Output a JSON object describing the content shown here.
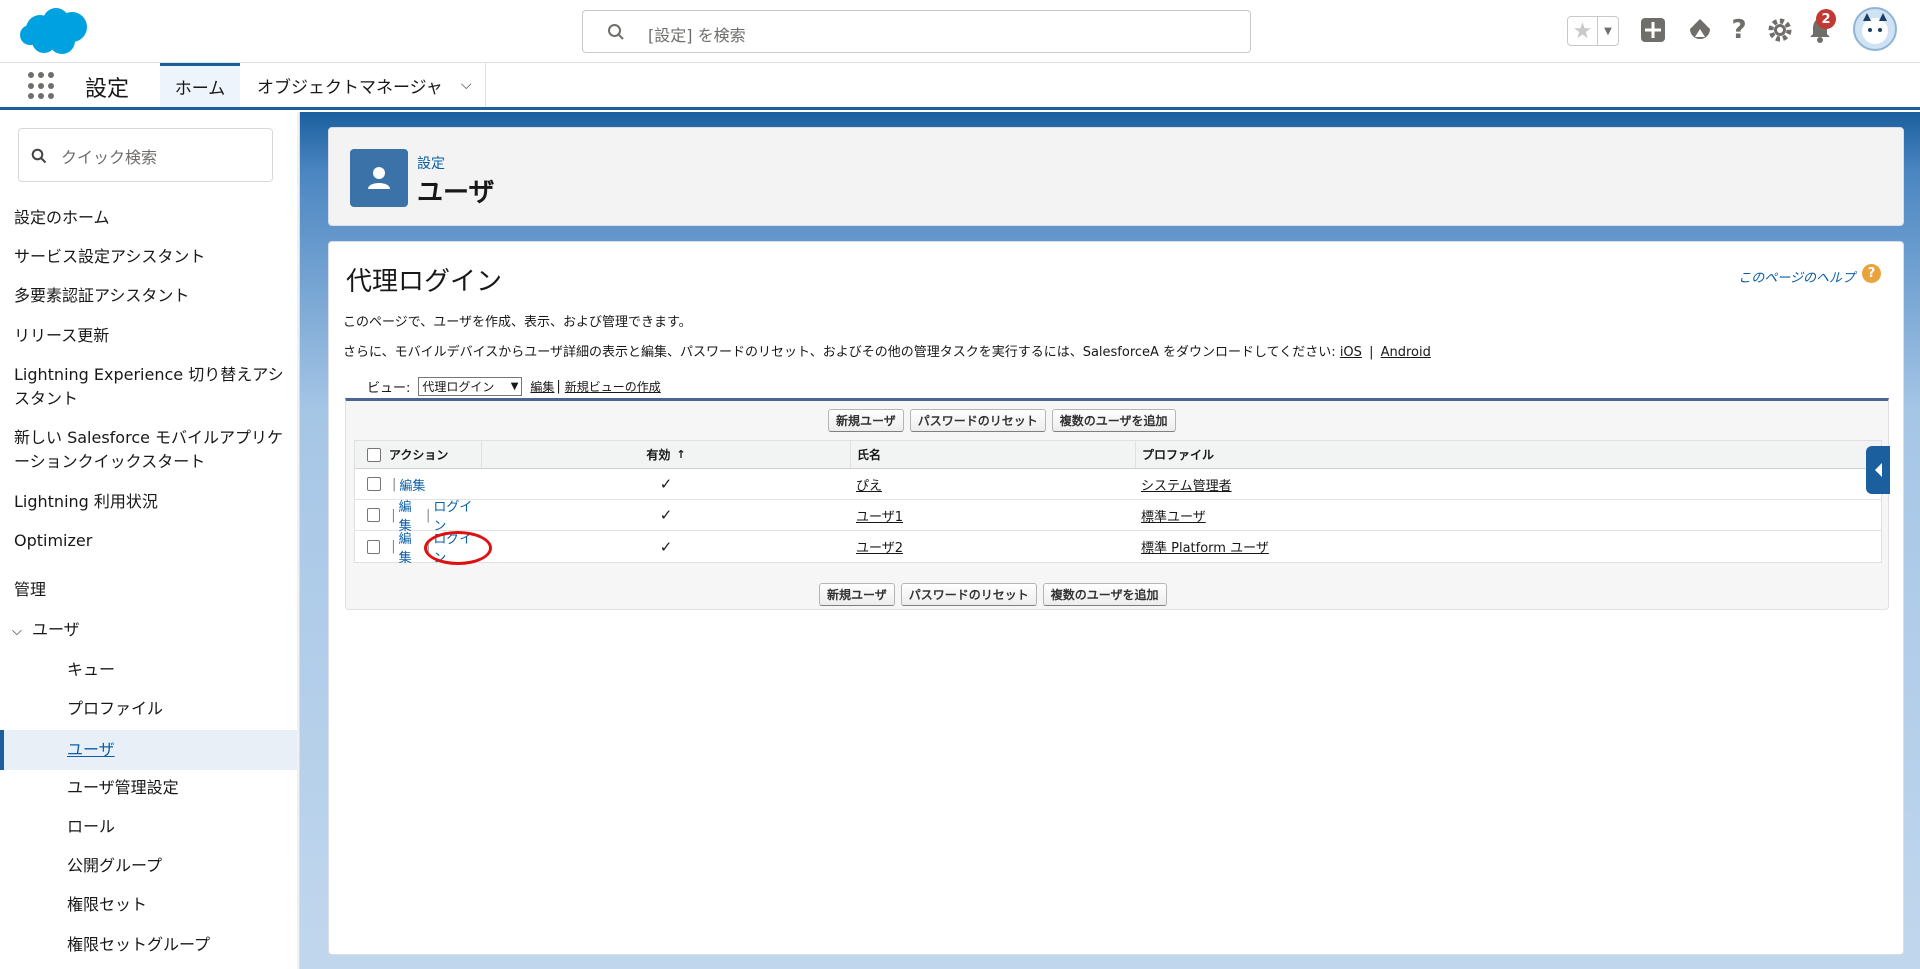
{
  "header": {
    "search_placeholder": "[設定] を検索",
    "notification_count": "2"
  },
  "nav": {
    "app_name": "設定",
    "tabs": [
      {
        "label": "ホーム"
      },
      {
        "label": "オブジェクトマネージャ"
      }
    ]
  },
  "sidebar": {
    "search_placeholder": "クイック検索",
    "items": [
      {
        "label": "設定のホーム"
      },
      {
        "label": "サービス設定アシスタント"
      },
      {
        "label": "多要素認証アシスタント"
      },
      {
        "label": "リリース更新"
      },
      {
        "label": "Lightning Experience 切り替えアシスタント"
      },
      {
        "label": "新しい Salesforce モバイルアプリケーションクイックスタート"
      },
      {
        "label": "Lightning 利用状況"
      },
      {
        "label": "Optimizer"
      }
    ],
    "section_admin": "管理",
    "group_users": "ユーザ",
    "sub_items": [
      {
        "label": "キュー"
      },
      {
        "label": "プロファイル"
      },
      {
        "label": "ユーザ"
      },
      {
        "label": "ユーザ管理設定"
      },
      {
        "label": "ロール"
      },
      {
        "label": "公開グループ"
      },
      {
        "label": "権限セット"
      },
      {
        "label": "権限セットグループ"
      }
    ]
  },
  "page_header": {
    "breadcrumb": "設定",
    "title": "ユーザ"
  },
  "content": {
    "view_title": "代理ログイン",
    "help_link": "このページのヘルプ",
    "desc1": "このページで、ユーザを作成、表示、および管理できます。",
    "desc2": "さらに、モバイルデバイスからユーザ詳細の表示と編集、パスワードのリセット、およびその他の管理タスクを実行するには、SalesforceA をダウンロードしてください:",
    "link_ios": "iOS",
    "link_android": "Android",
    "view_label": "ビュー:",
    "view_selected": "代理ログイン",
    "view_edit": "編集",
    "view_new": "新規ビューの作成",
    "buttons": {
      "new_user": "新規ユーザ",
      "reset_password": "パスワードのリセット",
      "add_multiple": "複数のユーザを追加"
    },
    "columns": {
      "action": "アクション",
      "active": "有効",
      "name": "氏名",
      "profile": "プロファイル"
    },
    "rows": [
      {
        "edit": "編集",
        "login": "",
        "active": "✓",
        "name": "ぴえ",
        "profile": "システム管理者"
      },
      {
        "edit": "編集",
        "login": "ログイン",
        "active": "✓",
        "name": "ユーザ1",
        "profile": "標準ユーザ"
      },
      {
        "edit": "編集",
        "login": "ログイン",
        "active": "✓",
        "name": "ユーザ2",
        "profile": "標準 Platform ユーザ"
      }
    ]
  }
}
